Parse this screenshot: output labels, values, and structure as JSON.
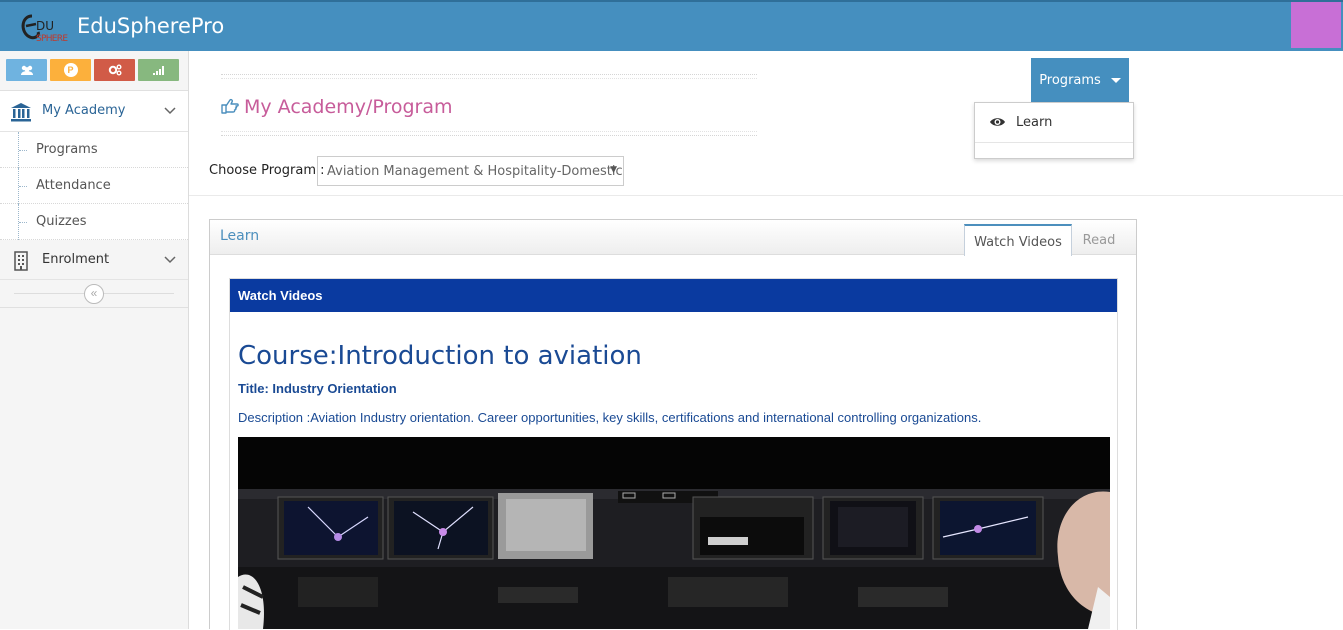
{
  "app": {
    "brand": "EduSpherePro",
    "logo_text": "DU"
  },
  "sidebar": {
    "shortcuts": [
      {
        "icon": "users-icon",
        "color": "#6fb3e0"
      },
      {
        "icon": "coin-icon",
        "color": "#fcb03c",
        "glyph": "P"
      },
      {
        "icon": "cogs-icon",
        "color": "#d15b47"
      },
      {
        "icon": "signal-icon",
        "color": "#87b87f"
      }
    ],
    "menu": [
      {
        "label": "My Academy",
        "icon": "bank-icon",
        "items": [
          "Programs",
          "Attendance",
          "Quizzes"
        ]
      },
      {
        "label": "Enrolment",
        "icon": "building-icon"
      }
    ],
    "collapse_glyph": "«"
  },
  "header": {
    "title": "My Academy/Program",
    "programs_button": "Programs",
    "dropdown": [
      {
        "label": "Learn",
        "icon": "eye-icon"
      }
    ]
  },
  "form": {
    "choose_label": "Choose Program :",
    "selected_program": "Aviation Management & Hospitality-Domestic"
  },
  "widget": {
    "title": "Learn",
    "tabs": [
      "Watch Videos",
      "Read"
    ],
    "active_tab": "Watch Videos",
    "panel_title": "Watch Videos",
    "course": "Course:Introduction to aviation",
    "lesson_title": "Title: Industry Orientation",
    "description": "Description :Aviation Industry orientation. Career opportunities, key skills, certifications and international controlling organizations."
  },
  "colors": {
    "topbar": "#458fbf",
    "accent_title": "#c75c9a",
    "panel_header": "#0a3aa0",
    "avatar": "#c86fd6"
  }
}
